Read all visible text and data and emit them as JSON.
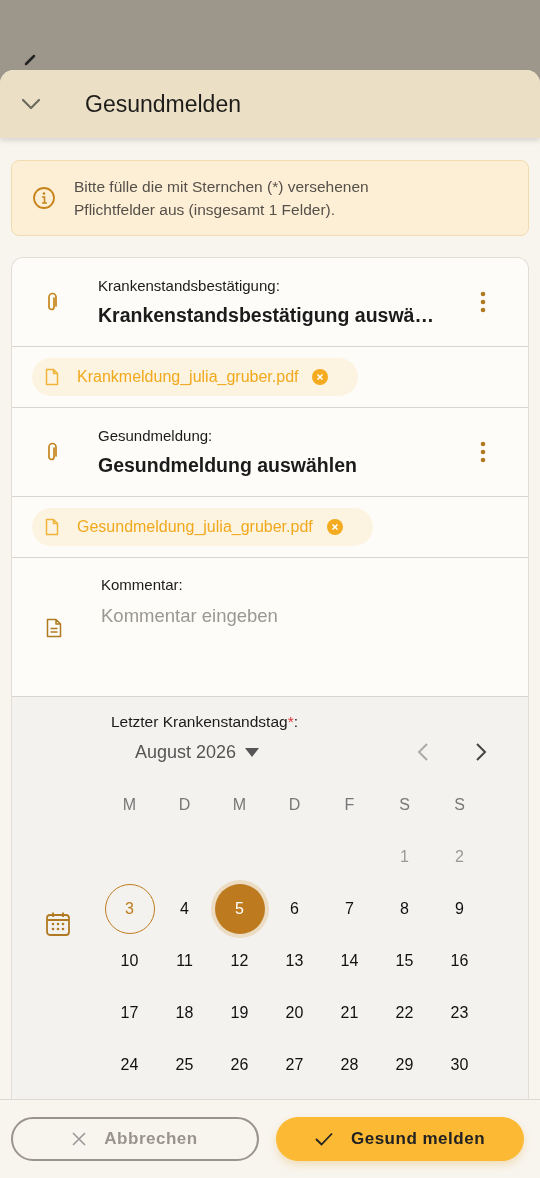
{
  "sheet": {
    "title": "Gesundmelden"
  },
  "notice": "Bitte fülle die mit Sternchen (*) versehenen Pflichtfelder aus (insgesamt 1 Felder).",
  "attachments": [
    {
      "label": "Krankenstandsbestätigung:",
      "value": "Krankenstandsbestätigung auswä…",
      "file": "Krankmeldung_julia_gruber.pdf"
    },
    {
      "label": "Gesundmeldung:",
      "value": "Gesundmeldung auswählen",
      "file": "Gesundmeldung_julia_gruber.pdf"
    }
  ],
  "comment": {
    "label": "Kommentar:",
    "placeholder": "Kommentar eingeben"
  },
  "date_picker": {
    "label": "Letzter Krankenstandstag",
    "required_mark": "*",
    "label_end": ":",
    "month": "August 2026",
    "weekdays": [
      "M",
      "D",
      "M",
      "D",
      "F",
      "S",
      "S"
    ],
    "weeks": [
      [
        {
          "kind": "blank"
        },
        {
          "kind": "blank"
        },
        {
          "kind": "blank"
        },
        {
          "kind": "blank"
        },
        {
          "kind": "blank"
        },
        {
          "day": "1",
          "kind": "muted",
          "selected": false
        },
        {
          "day": "2",
          "kind": "muted",
          "selected": false
        }
      ],
      [
        {
          "day": "3",
          "kind": "today",
          "selected": false
        },
        {
          "day": "4",
          "kind": "normal",
          "selected": false
        },
        {
          "day": "5",
          "kind": "normal",
          "selected": true
        },
        {
          "day": "6",
          "kind": "normal",
          "selected": false
        },
        {
          "day": "7",
          "kind": "normal",
          "selected": false
        },
        {
          "day": "8",
          "kind": "normal",
          "selected": false
        },
        {
          "day": "9",
          "kind": "normal",
          "selected": false
        }
      ],
      [
        {
          "day": "10",
          "kind": "normal",
          "selected": false
        },
        {
          "day": "11",
          "kind": "normal",
          "selected": false
        },
        {
          "day": "12",
          "kind": "normal",
          "selected": false
        },
        {
          "day": "13",
          "kind": "normal",
          "selected": false
        },
        {
          "day": "14",
          "kind": "normal",
          "selected": false
        },
        {
          "day": "15",
          "kind": "normal",
          "selected": false
        },
        {
          "day": "16",
          "kind": "normal",
          "selected": false
        }
      ],
      [
        {
          "day": "17",
          "kind": "normal",
          "selected": false
        },
        {
          "day": "18",
          "kind": "normal",
          "selected": false
        },
        {
          "day": "19",
          "kind": "normal",
          "selected": false
        },
        {
          "day": "20",
          "kind": "normal",
          "selected": false
        },
        {
          "day": "21",
          "kind": "normal",
          "selected": false
        },
        {
          "day": "22",
          "kind": "normal",
          "selected": false
        },
        {
          "day": "23",
          "kind": "normal",
          "selected": false
        }
      ],
      [
        {
          "day": "24",
          "kind": "normal",
          "selected": false
        },
        {
          "day": "25",
          "kind": "normal",
          "selected": false
        },
        {
          "day": "26",
          "kind": "normal",
          "selected": false
        },
        {
          "day": "27",
          "kind": "normal",
          "selected": false
        },
        {
          "day": "28",
          "kind": "normal",
          "selected": false
        },
        {
          "day": "29",
          "kind": "normal",
          "selected": false
        },
        {
          "day": "30",
          "kind": "normal",
          "selected": false
        }
      ]
    ]
  },
  "buttons": {
    "cancel": "Abbrechen",
    "confirm": "Gesund melden"
  }
}
